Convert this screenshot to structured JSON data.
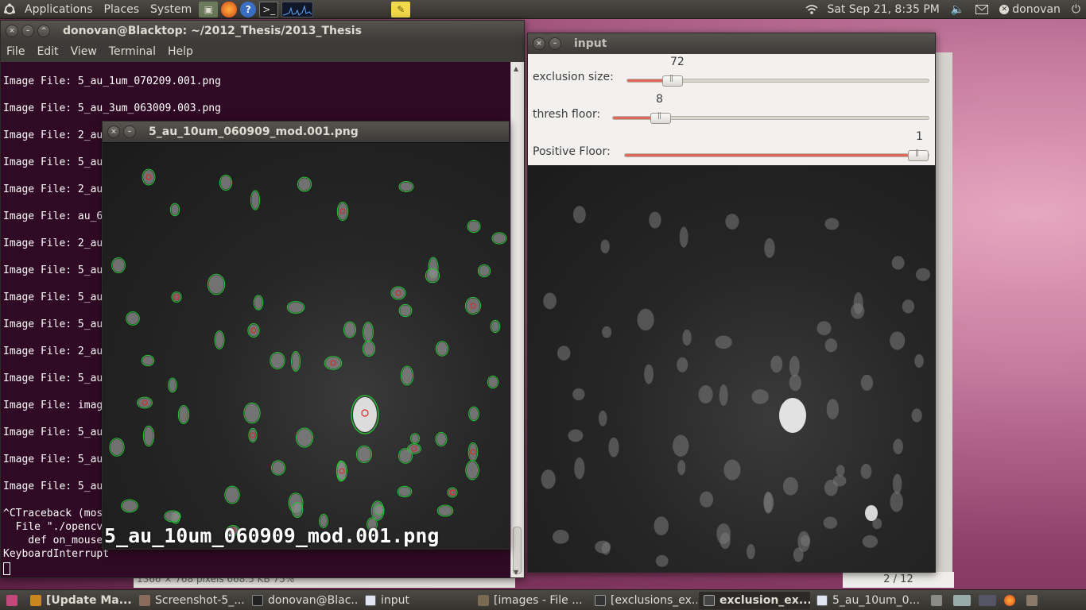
{
  "top_panel": {
    "menus": [
      "Applications",
      "Places",
      "System"
    ],
    "clock": "Sat Sep 21,  8:35 PM",
    "user": "donovan"
  },
  "terminal": {
    "title": "donovan@Blacktop: ~/2012_Thesis/2013_Thesis",
    "menu": [
      "File",
      "Edit",
      "View",
      "Terminal",
      "Help"
    ],
    "lines": [
      "Image File: 5_au_1um_070209.001.png",
      "Image File: 5_au_3um_063009.003.png",
      "Image File: 2_au",
      "Image File: 5_au",
      "Image File: 2_au",
      "Image File: au_6",
      "Image File: 2_au",
      "Image File: 5_au",
      "Image File: 5_au",
      "Image File: 5_au",
      "Image File: 2_au",
      "Image File: 5_au",
      "Image File: imag",
      "Image File: 5_au",
      "Image File: 5_au",
      "Image File: 5_au",
      "^CTraceback (mos",
      "  File \"./opencv",
      "    def on_mouse",
      "KeyboardInterrupt"
    ]
  },
  "image_window": {
    "title": "5_au_10um_060909_mod.001.png",
    "caption": "5_au_10um_060909_mod.001.png"
  },
  "input_window": {
    "title": "input",
    "sliders": [
      {
        "label": "exclusion size:",
        "value": "72",
        "level": 0.15
      },
      {
        "label": "thresh floor:",
        "value": "8",
        "level": 0.15
      },
      {
        "label": "Positive Floor:",
        "value": "1",
        "level": 0.97
      }
    ]
  },
  "viewer": {
    "page_indicator": "2 / 12",
    "status": "1366 × 768 pixels  668.5 KB   75%"
  },
  "taskbar": {
    "tasks": [
      "[Update Ma...",
      "Screenshot-5_...",
      "donovan@Blac...",
      "input",
      "[images - File ...",
      "[exclusions_ex...",
      "exclusion_ex...",
      "5_au_10um_0..."
    ],
    "active_index": 6
  },
  "colors": {
    "contour": "#22cc33",
    "centroid": "#dd2222",
    "slider_fill": "#e0685b",
    "terminal_bg": "#300a24"
  }
}
